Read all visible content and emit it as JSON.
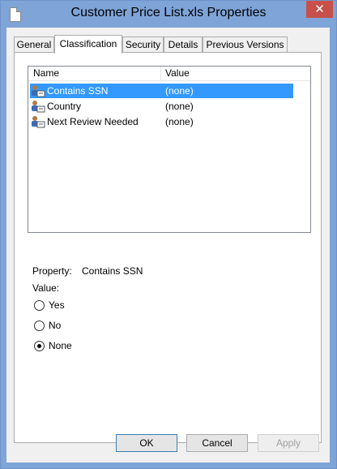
{
  "window": {
    "title": "Customer Price List.xls Properties",
    "close_glyph": "✕",
    "colors": {
      "frame": "#7ea4d8",
      "close": "#c7514a",
      "selection": "#3399ff"
    }
  },
  "tabs": [
    {
      "label": "General",
      "active": false
    },
    {
      "label": "Classification",
      "active": true
    },
    {
      "label": "Security",
      "active": false
    },
    {
      "label": "Details",
      "active": false
    },
    {
      "label": "Previous Versions",
      "active": false
    }
  ],
  "list": {
    "columns": {
      "name": "Name",
      "value": "Value"
    },
    "rows": [
      {
        "name": "Contains SSN",
        "value": "(none)",
        "selected": true,
        "icon": "classification-property-icon"
      },
      {
        "name": "Country",
        "value": "(none)",
        "selected": false,
        "icon": "classification-property-icon"
      },
      {
        "name": "Next Review Needed",
        "value": "(none)",
        "selected": false,
        "icon": "classification-property-icon"
      }
    ]
  },
  "property": {
    "label": "Property:",
    "value": "Contains SSN"
  },
  "value_group": {
    "label": "Value:",
    "options": [
      {
        "label": "Yes",
        "checked": false
      },
      {
        "label": "No",
        "checked": false
      },
      {
        "label": "None",
        "checked": true
      }
    ]
  },
  "buttons": {
    "ok": "OK",
    "cancel": "Cancel",
    "apply": "Apply"
  }
}
